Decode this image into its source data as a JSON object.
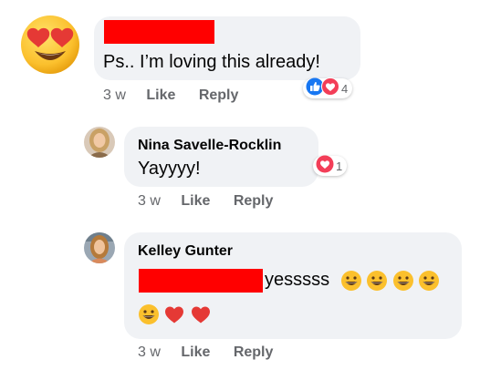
{
  "comments": [
    {
      "author_redacted": true,
      "text": "Ps.. I’m loving this already!",
      "time": "3 w",
      "like_label": "Like",
      "reply_label": "Reply",
      "reaction_count": "4",
      "reactions": [
        "like",
        "love"
      ]
    },
    {
      "author": "Nina Savelle-Rocklin",
      "text": "Yayyyy!",
      "time": "3 w",
      "like_label": "Like",
      "reply_label": "Reply",
      "reaction_count": "1",
      "reactions": [
        "love"
      ]
    },
    {
      "author": "Kelley Gunter",
      "mention_redacted": true,
      "text": "yesssss",
      "emojis": [
        "grinning-face",
        "grinning-face",
        "grinning-face",
        "grinning-face",
        "grinning-face",
        "red-heart",
        "red-heart"
      ],
      "time": "3 w",
      "like_label": "Like",
      "reply_label": "Reply"
    }
  ],
  "colors": {
    "bubble": "#f0f2f5",
    "meta_text": "#65676b",
    "redaction": "#ff0000",
    "like_blue": "#1877f2",
    "love_red": "#f33e58"
  }
}
